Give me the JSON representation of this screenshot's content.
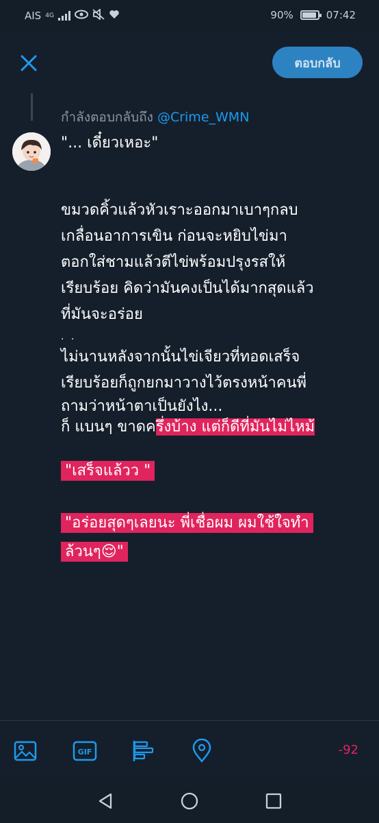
{
  "status_bar": {
    "carrier": "AIS",
    "network": "4G",
    "battery_percent": "90%",
    "battery_level": 0.9,
    "time": "07:42"
  },
  "header": {
    "reply_button_label": "ตอบกลับ"
  },
  "reply_context": {
    "prefix": "กำลังตอบกลับถึง",
    "handle": "@Crime_WMN"
  },
  "tweet": {
    "line1": "\"... เดี๋ยวเหอะ\"",
    "para2": [
      "ขมวดคิ้วแล้วหัวเราะออกมาเบาๆกลบ",
      "เกลื่อนอาการเขิน ก่อนจะหยิบไข่มา",
      "ตอกใส่ชามแล้วตีไข่พร้อมปรุงรสให้",
      "เรียบร้อย คิดว่ามันคงเป็นได้มากสุดแล้ว",
      "ที่มันจะอร่อย"
    ],
    "dots": ". .",
    "para3": [
      "ไม่นานหลังจากนั้นไข่เจียวที่ทอดเสร็จ",
      "เรียบร้อยก็ถูกยกมาวางไว้ตรงหน้าคนพี่",
      "ถามว่าหน้าตาเป็นยังไง..."
    ],
    "line_mixed_plain": "ก็ แบนๆ ขาดค",
    "line_mixed_highlight": "รึ่งบ้าง แต่ก็ดีที่มันไม่ไหม้",
    "quote1": "\"เสร็จแล้วว \"",
    "quote2_line1": "\"อร่อยสุดๆเลยนะ พี่เชื่อผม  ผมใช้ใจทำ",
    "quote2_line2": "ล้วนๆ😌\""
  },
  "toolbar": {
    "char_counter": "-92"
  },
  "colors": {
    "background": "#151f2b",
    "accent": "#1d9bf0",
    "reply_button": "#2d82c2",
    "highlight": "#e0245e"
  }
}
